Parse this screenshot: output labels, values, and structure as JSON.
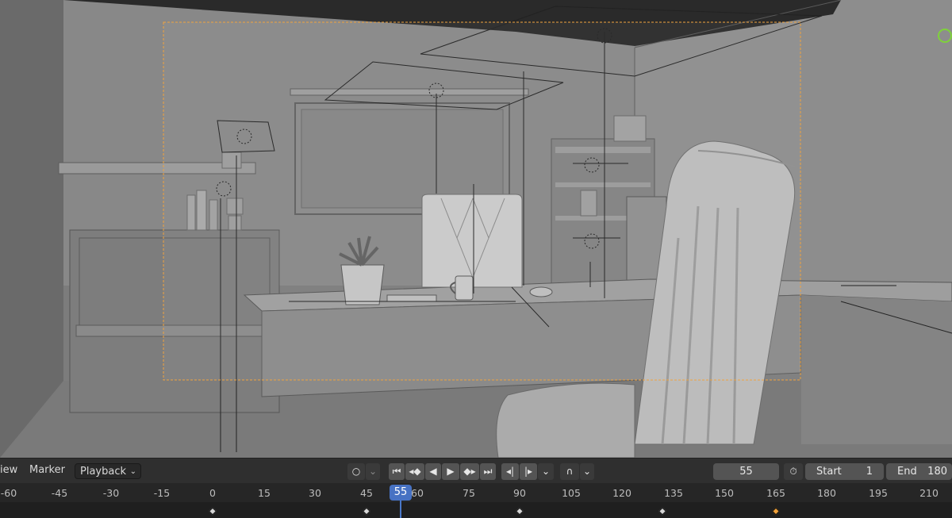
{
  "timeline_header": {
    "view_menu": "iew",
    "marker_menu": "Marker",
    "playback_menu": "Playback",
    "current_frame": "55",
    "start_label": "Start",
    "start_value": "1",
    "end_label": "End",
    "end_value": "180"
  },
  "ruler": {
    "ticks": [
      "-60",
      "-45",
      "-30",
      "-15",
      "0",
      "15",
      "30",
      "45",
      "60",
      "75",
      "90",
      "105",
      "120",
      "135",
      "150",
      "165",
      "180",
      "195",
      "210"
    ],
    "playhead_label": "55"
  },
  "icons": {
    "record": "record-icon",
    "jump_start": "jump-start-icon",
    "prev_keyframe": "prev-keyframe-icon",
    "play_reverse": "play-reverse-icon",
    "play": "play-icon",
    "next_keyframe": "next-keyframe-icon",
    "jump_end": "jump-end-icon",
    "prev_marker": "prev-marker-icon",
    "next_marker": "next-marker-icon",
    "snap": "snap-icon",
    "stopwatch": "stopwatch-icon"
  },
  "colors": {
    "camera_frame": "#f0a13a",
    "playhead": "#4772c3",
    "selected_keyframe": "#f0a13a",
    "gizmo": "#7fd13b"
  }
}
